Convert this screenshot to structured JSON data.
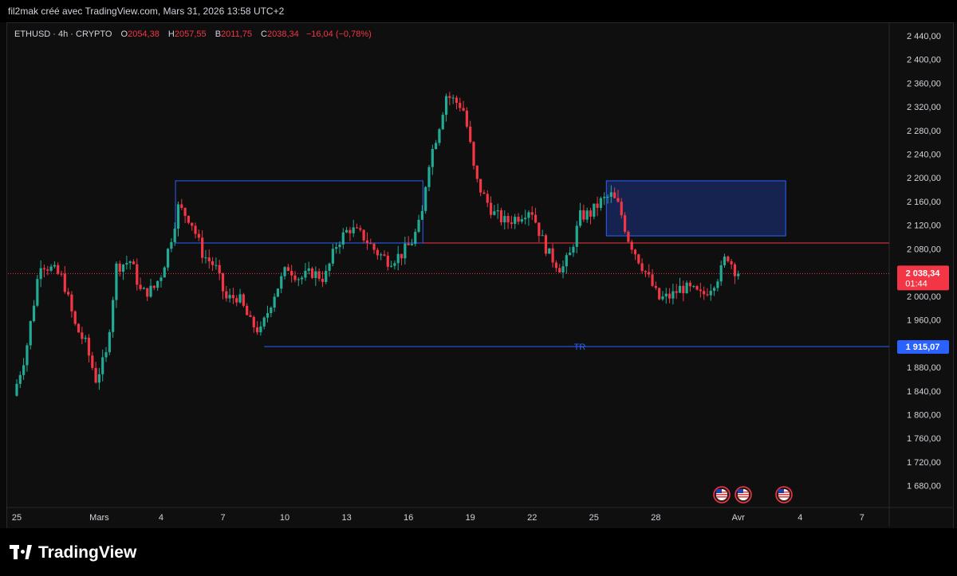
{
  "header": {
    "title": "fil2mak créé avec TradingView.com, Mars 31, 2026 13:58 UTC+2"
  },
  "legend": {
    "symbol": "ETHUSD · 4h · CRYPTO",
    "o_label": "O",
    "o_value": "2054,38",
    "h_label": "H",
    "h_value": "2057,55",
    "b_label": "B",
    "b_value": "2011,75",
    "c_label": "C",
    "c_value": "2038,34",
    "change": "−16,04 (−0,78%)"
  },
  "footer": {
    "brand": "TradingView"
  },
  "colors": {
    "up": "#22ab94",
    "down": "#f23645",
    "zone": "#1f3a93",
    "tr_line": "#2962ff"
  },
  "chart_data": {
    "type": "candlestick",
    "symbol": "ETHUSD",
    "interval": "4h",
    "ylim": [
      1650,
      2460
    ],
    "y_ticks": [
      "2 440,00",
      "2 400,00",
      "2 360,00",
      "2 320,00",
      "2 280,00",
      "2 240,00",
      "2 200,00",
      "2 160,00",
      "2 120,00",
      "2 080,00",
      "2 040,00",
      "2 000,00",
      "1 960,00",
      "1 920,00",
      "1 880,00",
      "1 840,00",
      "1 800,00",
      "1 760,00",
      "1 720,00",
      "1 680,00"
    ],
    "y_tick_values": [
      2440,
      2400,
      2360,
      2320,
      2280,
      2240,
      2200,
      2160,
      2120,
      2080,
      2040,
      2000,
      1960,
      1920,
      1880,
      1840,
      1800,
      1760,
      1720,
      1680
    ],
    "x_ticks": [
      "25",
      "Mars",
      "4",
      "7",
      "10",
      "13",
      "16",
      "19",
      "22",
      "25",
      "28",
      "Avr",
      "4",
      "7"
    ],
    "x_tick_days": [
      0,
      4,
      7,
      10,
      13,
      16,
      19,
      22,
      25,
      28,
      31,
      35,
      38,
      41
    ],
    "last_price": {
      "value": 2038.34,
      "label": "2 038,34",
      "countdown": "01:44"
    },
    "tr_level": {
      "value": 1915.07,
      "label": "1 915,07",
      "text": "TR",
      "x_from_day": 12.0
    },
    "range_box": {
      "x_from_day": 7.7,
      "x_to_day": 19.7,
      "y_top": 2195,
      "y_bottom": 2090
    },
    "supply_zone": {
      "x_from_day": 28.6,
      "x_to_day": 37.3,
      "y_top": 2195,
      "y_bottom": 2102
    },
    "resistance_line": {
      "value": 2090,
      "x_from_day": 19.7
    },
    "price_anchors": [
      [
        0,
        1832
      ],
      [
        0.6,
        1905
      ],
      [
        1,
        1990
      ],
      [
        1.3,
        2058
      ],
      [
        1.9,
        2045
      ],
      [
        2.4,
        2030
      ],
      [
        3.0,
        1950
      ],
      [
        3.5,
        1920
      ],
      [
        4.0,
        1860
      ],
      [
        4.5,
        1900
      ],
      [
        5.0,
        2050
      ],
      [
        5.7,
        2060
      ],
      [
        6.2,
        2005
      ],
      [
        6.8,
        2012
      ],
      [
        7.2,
        2040
      ],
      [
        7.6,
        2090
      ],
      [
        8.0,
        2150
      ],
      [
        8.6,
        2130
      ],
      [
        9.2,
        2070
      ],
      [
        9.8,
        2050
      ],
      [
        10.3,
        1995
      ],
      [
        10.9,
        2000
      ],
      [
        11.5,
        1955
      ],
      [
        12.0,
        1940
      ],
      [
        12.6,
        2000
      ],
      [
        13.3,
        2050
      ],
      [
        13.9,
        2030
      ],
      [
        14.5,
        2040
      ],
      [
        15.1,
        2030
      ],
      [
        15.7,
        2090
      ],
      [
        16.3,
        2115
      ],
      [
        17.0,
        2100
      ],
      [
        17.6,
        2075
      ],
      [
        18.2,
        2060
      ],
      [
        18.8,
        2070
      ],
      [
        19.3,
        2090
      ],
      [
        19.8,
        2130
      ],
      [
        20.1,
        2220
      ],
      [
        20.6,
        2280
      ],
      [
        21.0,
        2340
      ],
      [
        21.4,
        2330
      ],
      [
        21.8,
        2320
      ],
      [
        22.1,
        2270
      ],
      [
        22.4,
        2200
      ],
      [
        22.8,
        2170
      ],
      [
        23.3,
        2140
      ],
      [
        23.9,
        2125
      ],
      [
        24.5,
        2135
      ],
      [
        25.1,
        2150
      ],
      [
        25.6,
        2100
      ],
      [
        26.0,
        2070
      ],
      [
        26.6,
        2045
      ],
      [
        27.0,
        2070
      ],
      [
        27.5,
        2135
      ],
      [
        28.0,
        2140
      ],
      [
        28.5,
        2160
      ],
      [
        29.0,
        2170
      ],
      [
        29.4,
        2150
      ],
      [
        29.8,
        2100
      ],
      [
        30.3,
        2065
      ],
      [
        30.9,
        2025
      ],
      [
        31.3,
        1995
      ],
      [
        31.9,
        2000
      ],
      [
        32.4,
        2015
      ],
      [
        32.9,
        2010
      ],
      [
        33.4,
        2000
      ],
      [
        33.9,
        2020
      ],
      [
        34.3,
        2040
      ],
      [
        34.6,
        2072
      ],
      [
        35.1,
        2038
      ]
    ]
  }
}
